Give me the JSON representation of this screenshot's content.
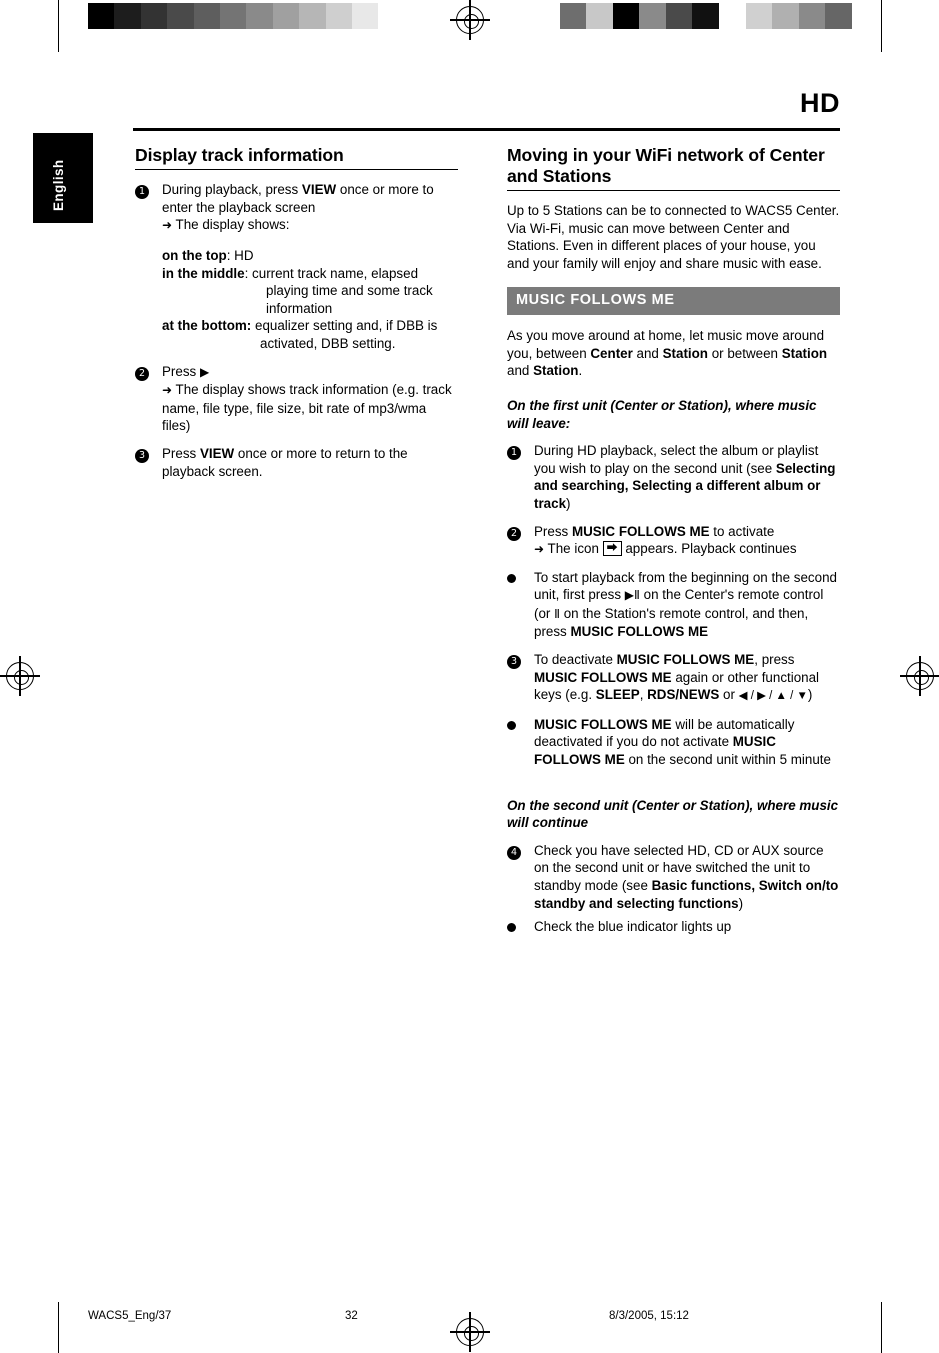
{
  "page": {
    "header_title": "HD",
    "language_tab": "English"
  },
  "greyscale": {
    "left_bar": [
      "#000000",
      "#1d1d1d",
      "#333333",
      "#4a4a4a",
      "#5e5e5e",
      "#747474",
      "#8a8a8a",
      "#a0a0a0",
      "#b6b6b6",
      "#cfcfcf",
      "#e8e8e8",
      "#ffffff"
    ],
    "right_bar": [
      "#ffffff",
      "#6e6e6e",
      "#c8c8c8",
      "#000000",
      "#8a8a8a",
      "#4a4a4a",
      "#111111",
      "#ffffff",
      "#d0d0d0",
      "#b0b0b0",
      "#8a8a8a",
      "#666666"
    ]
  },
  "left_column": {
    "title": "Display track information",
    "steps": [
      {
        "marker": "1",
        "text_before": "During playback, press ",
        "bold": "VIEW",
        "text_after": " once or more to enter the playback screen"
      }
    ],
    "display_shows_arrow": "The display shows:",
    "display_lines": [
      {
        "label": "on the top",
        "sep": ": ",
        "value": "HD"
      },
      {
        "label": "in the middle",
        "sep": ": ",
        "value": "current track name, elapsed playing time and some track information"
      },
      {
        "label": "at the bottom:",
        "sep": " ",
        "value": "equalizer setting and, if DBB is activated, DBB setting."
      }
    ],
    "step2": {
      "marker": "2",
      "label": "Press ",
      "symbol": "▶",
      "arrow_text": "The display shows track information (e.g. track name, file type, file size, bit rate of mp3/wma files)"
    },
    "step3": {
      "marker": "3",
      "text_before": "Press ",
      "bold": "VIEW",
      "text_after": " once or more to return to the playback screen."
    }
  },
  "right_column": {
    "title": "Moving in your WiFi network of Center and Stations",
    "intro": "Up to 5 Stations can be to connected to WACS5 Center. Via Wi-Fi,  music can move between Center and Stations. Even in different places of your house, you and your family will enjoy and share music with ease.",
    "band_label": "MUSIC FOLLOWS ME",
    "band_color": "#7b7b7b",
    "para_after_band": {
      "p1": "As you move around at home, let music move around you, between ",
      "b1": "Center",
      "p2": " and ",
      "b2": "Station",
      "p3": "  or between ",
      "b3": "Station",
      "p4": " and ",
      "b4": "Station",
      "p5": "."
    },
    "subheading_1": "On the first unit (Center or Station), where music will leave:",
    "steps": [
      {
        "marker": "1",
        "t1": "During HD playback, select the album or playlist you wish to play on the second unit (see ",
        "b1": "Selecting and searching, Selecting a different album or track",
        "t2": ")"
      },
      {
        "marker": "2",
        "t1": "Press ",
        "b1": "MUSIC FOLLOWS ME",
        "t2": " to activate",
        "arrow_t1": "The icon ",
        "arrow_icon": "⮕",
        "arrow_t2": " appears. Playback continues"
      },
      {
        "marker": "bullet",
        "t1": "To start playback from the beginning on the second unit,  first press ",
        "sym1": "▶Ⅱ",
        "t2": " on the Center's remote control (or ",
        "sym2": "Ⅱ",
        "t3": " on the Station's remote control, and then, press ",
        "b1": "MUSIC FOLLOWS ME"
      },
      {
        "marker": "3",
        "t1": "To deactivate ",
        "b1": "MUSIC FOLLOWS ME",
        "t2": ", press ",
        "b2": "MUSIC FOLLOWS ME",
        "t3": " again or other functional keys (e.g. ",
        "b3": "SLEEP",
        "t4": ", ",
        "b4": "RDS/NEWS",
        "t5": " or ",
        "syms": "◀ / ▶ / ▲ / ▼",
        "t6": ")"
      },
      {
        "marker": "bullet",
        "b1": "MUSIC FOLLOWS ME",
        "t1": " will be automatically deactivated if you do not activate ",
        "b2": "MUSIC FOLLOWS ME",
        "t2": " on the second unit within 5 minute"
      }
    ],
    "subheading_2": "On the second unit (Center or Station), where music will continue",
    "steps2": [
      {
        "marker": "4",
        "t1": "Check you have selected HD, CD or AUX source on the second unit or have switched the unit to standby mode (see ",
        "b1": "Basic functions, Switch on/to standby and selecting functions",
        "t2": ")"
      },
      {
        "marker": "bullet",
        "t1": "Check the blue indicator lights up"
      }
    ]
  },
  "footer": {
    "file": "WACS5_Eng/37",
    "page_number": "32",
    "date": "8/3/2005, 15:12"
  }
}
